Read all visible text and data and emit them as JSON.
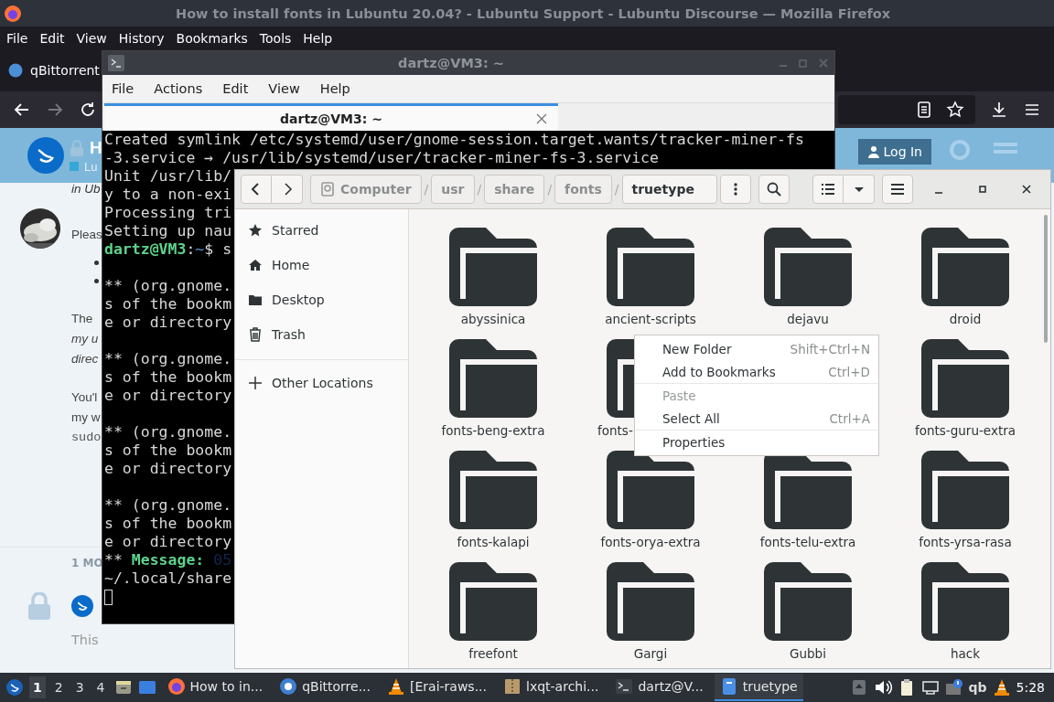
{
  "browser": {
    "title": "How to install fonts in Lubuntu 20.04? - Lubuntu Support - Lubuntu Discourse — Mozilla Firefox",
    "menu": [
      "File",
      "Edit",
      "View",
      "History",
      "Bookmarks",
      "Tools",
      "Help"
    ],
    "tab": {
      "label": "qBittorrent"
    },
    "page": {
      "topic_title": "H",
      "category": "Lu",
      "login": "Log In",
      "intro": {
        "text": "in Ub",
        "italic": true
      },
      "greeting": "Pleas",
      "paragraphs": [
        [
          {
            "text": "The",
            "italic": false,
            "code": false
          },
          {
            "text": "my u",
            "italic": true,
            "code": false
          },
          {
            "text": "direc",
            "italic": true,
            "code": false
          }
        ],
        [
          {
            "text": "You'l",
            "italic": false,
            "code": false
          },
          {
            "text": "my w",
            "italic": false,
            "code": false
          },
          {
            "text": "sudo",
            "italic": false,
            "code": true
          }
        ]
      ],
      "meta": "1 MO",
      "reply": "This"
    }
  },
  "terminal": {
    "title": "dartz@VM3: ~",
    "menu": [
      "File",
      "Actions",
      "Edit",
      "View",
      "Help"
    ],
    "tabs": [
      {
        "label": "dartz@VM3: ~",
        "selected": true
      }
    ],
    "lines": [
      {
        "kind": "text",
        "text": "Created symlink /etc/systemd/user/gnome-session.target.wants/tracker-miner-fs"
      },
      {
        "kind": "text",
        "text": "-3.service → /usr/lib/systemd/user/tracker-miner-fs-3.service"
      },
      {
        "kind": "text",
        "text": "Unit /usr/lib/"
      },
      {
        "kind": "text",
        "text": "y to a non-exi"
      },
      {
        "kind": "text",
        "text": "Processing tri"
      },
      {
        "kind": "text",
        "text": "Setting up nau"
      },
      {
        "kind": "prompt",
        "user": "dartz@VM3",
        "sep": ":",
        "path": "~",
        "rest": "$ s"
      },
      {
        "kind": "blank"
      },
      {
        "kind": "text",
        "text": "** (org.gnome."
      },
      {
        "kind": "text",
        "text": "s of the bookm"
      },
      {
        "kind": "text",
        "text": "e or directory"
      },
      {
        "kind": "blank"
      },
      {
        "kind": "text",
        "text": "** (org.gnome."
      },
      {
        "kind": "text",
        "text": "s of the bookm"
      },
      {
        "kind": "text",
        "text": "e or directory"
      },
      {
        "kind": "blank"
      },
      {
        "kind": "text",
        "text": "** (org.gnome."
      },
      {
        "kind": "text",
        "text": "s of the bookm"
      },
      {
        "kind": "text",
        "text": "e or directory"
      },
      {
        "kind": "blank"
      },
      {
        "kind": "text",
        "text": "** (org.gnome."
      },
      {
        "kind": "text",
        "text": "s of the bookm"
      },
      {
        "kind": "text",
        "text": "e or directory"
      },
      {
        "kind": "message",
        "prefix": "**",
        "label": "Message:",
        "time": "05"
      },
      {
        "kind": "text",
        "text": "~/.local/share"
      },
      {
        "kind": "cursor"
      }
    ]
  },
  "file_manager": {
    "separator": "/",
    "path": [
      {
        "label": "Computer",
        "kind": "drive",
        "selected": false
      },
      {
        "label": "usr",
        "kind": "plain",
        "selected": false
      },
      {
        "label": "share",
        "kind": "plain",
        "selected": false
      },
      {
        "label": "fonts",
        "kind": "plain",
        "selected": false
      },
      {
        "label": "truetype",
        "kind": "plain",
        "selected": true
      }
    ],
    "sidebar": {
      "places": [
        {
          "label": "Starred",
          "kind": "star"
        },
        {
          "label": "Home",
          "kind": "home"
        },
        {
          "label": "Desktop",
          "kind": "folder"
        },
        {
          "label": "Trash",
          "kind": "trash"
        }
      ],
      "other": [
        {
          "label": "Other Locations",
          "kind": "plus"
        }
      ]
    },
    "folders": [
      {
        "kind": "folder",
        "name": "abyssinica"
      },
      {
        "kind": "folder",
        "name": "ancient-scripts"
      },
      {
        "kind": "folder",
        "name": "dejavu"
      },
      {
        "kind": "folder",
        "name": "droid"
      },
      {
        "kind": "folder",
        "name": "fonts-beng-extra"
      },
      {
        "kind": "partial",
        "name": "fonts-"
      },
      {
        "kind": "covered"
      },
      {
        "kind": "folder",
        "name": "fonts-guru-extra"
      },
      {
        "kind": "folder",
        "name": "fonts-kalapi"
      },
      {
        "kind": "folder",
        "name": "fonts-orya-extra"
      },
      {
        "kind": "folder",
        "name": "fonts-telu-extra"
      },
      {
        "kind": "folder",
        "name": "fonts-yrsa-rasa"
      },
      {
        "kind": "folder",
        "name": "freefont"
      },
      {
        "kind": "folder",
        "name": "Gargi"
      },
      {
        "kind": "folder",
        "name": "Gubbi"
      },
      {
        "kind": "folder",
        "name": "hack"
      }
    ]
  },
  "context_menu": {
    "items": [
      {
        "label": "New Folder",
        "shortcut": "Shift+Ctrl+N",
        "disabled": false,
        "separator_before": false
      },
      {
        "label": "Add to Bookmarks",
        "shortcut": "Ctrl+D",
        "disabled": false,
        "separator_before": false
      },
      {
        "label": "Paste",
        "disabled": true,
        "separator_before": true
      },
      {
        "label": "Select All",
        "shortcut": "Ctrl+A",
        "disabled": false,
        "separator_before": false
      },
      {
        "label": "Properties",
        "disabled": false,
        "separator_before": true
      }
    ]
  },
  "taskbar": {
    "workspaces": [
      {
        "label": "1",
        "selected": true
      },
      {
        "label": "2",
        "selected": false
      },
      {
        "label": "3",
        "selected": false
      },
      {
        "label": "4",
        "selected": false
      }
    ],
    "tasks": [
      {
        "kind": "firefox",
        "label": "How to in...",
        "selected": false
      },
      {
        "kind": "qbittorrent",
        "label": "qBittorre...",
        "selected": false
      },
      {
        "kind": "vlc",
        "label": "[Erai-raws...",
        "selected": false
      },
      {
        "kind": "archive",
        "label": "lxqt-archi...",
        "selected": false
      },
      {
        "kind": "terminal",
        "label": "dartz@V...",
        "selected": false
      },
      {
        "kind": "files",
        "label": "truetype",
        "selected": true
      }
    ],
    "tray": {
      "qb": "qb",
      "clock": "5:28"
    }
  }
}
